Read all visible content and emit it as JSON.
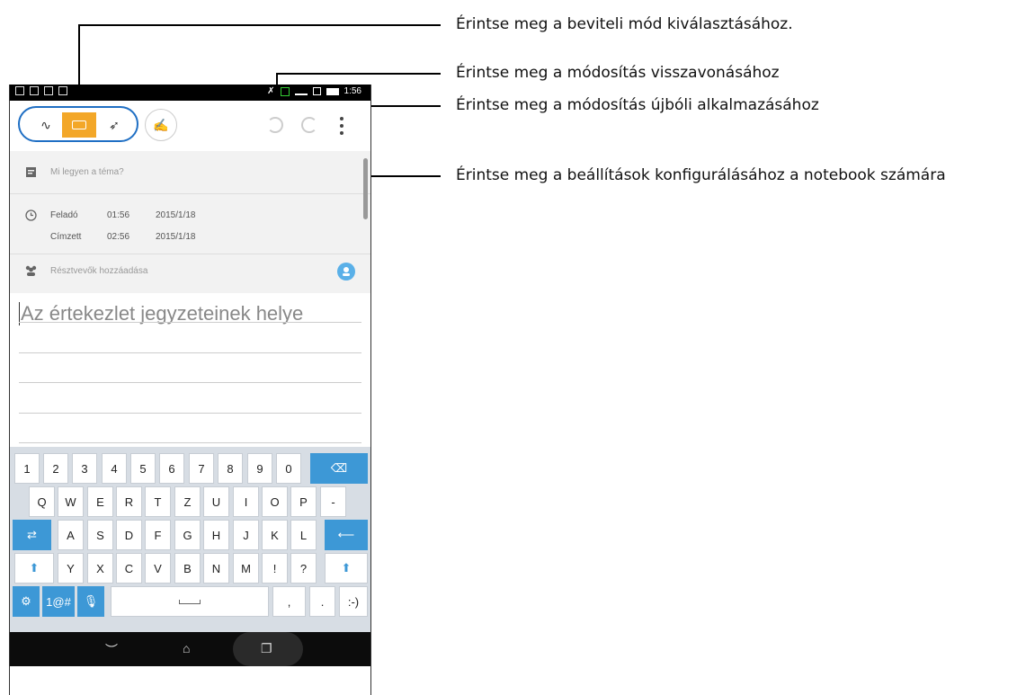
{
  "callouts": {
    "input_mode": "Érintse meg a beviteli mód kiválasztásához.",
    "undo": "Érintse meg a módosítás visszavonásához",
    "redo": "Érintse meg a módosítás újbóli alkalmazásához",
    "settings": "Érintse meg a beállítások konfigurálásához a notebook számára"
  },
  "status_bar": {
    "time": "1:56"
  },
  "form": {
    "topic_placeholder": "Mi legyen a téma?",
    "from_label": "Feladó",
    "from_time": "01:56",
    "from_date": "2015/1/18",
    "to_label": "Címzett",
    "to_time": "02:56",
    "to_date": "2015/1/18",
    "participants_placeholder": "Résztvevők hozzáadása"
  },
  "notes": {
    "placeholder": "Az értekezlet jegyzeteinek helye"
  },
  "keyboard": {
    "row1": [
      "1",
      "2",
      "3",
      "4",
      "5",
      "6",
      "7",
      "8",
      "9",
      "0"
    ],
    "row2": [
      "Q",
      "W",
      "E",
      "R",
      "T",
      "Z",
      "U",
      "I",
      "O",
      "P",
      "-"
    ],
    "row3": [
      "A",
      "S",
      "D",
      "F",
      "G",
      "H",
      "J",
      "K",
      "L"
    ],
    "row4": [
      "Y",
      "X",
      "C",
      "V",
      "B",
      "N",
      "M",
      "!",
      "?"
    ],
    "symbols_label": "1@#",
    "comma": ",",
    "period": ".",
    "smiley": ":-)"
  },
  "colors": {
    "accent_orange": "#f3a728",
    "accent_blue": "#3d98d6",
    "pill_border": "#1f6fc4"
  },
  "icons": [
    "handwriting-icon",
    "keyboard-icon",
    "brush-icon",
    "pen-style-icon",
    "undo-icon",
    "redo-icon",
    "more-icon",
    "calendar-note-icon",
    "clock-icon",
    "people-icon",
    "add-participant-icon",
    "backspace-icon",
    "tab-icon",
    "enter-icon",
    "shift-icon",
    "settings-icon",
    "mic-icon",
    "space-icon",
    "back-icon",
    "home-icon",
    "recents-icon"
  ]
}
